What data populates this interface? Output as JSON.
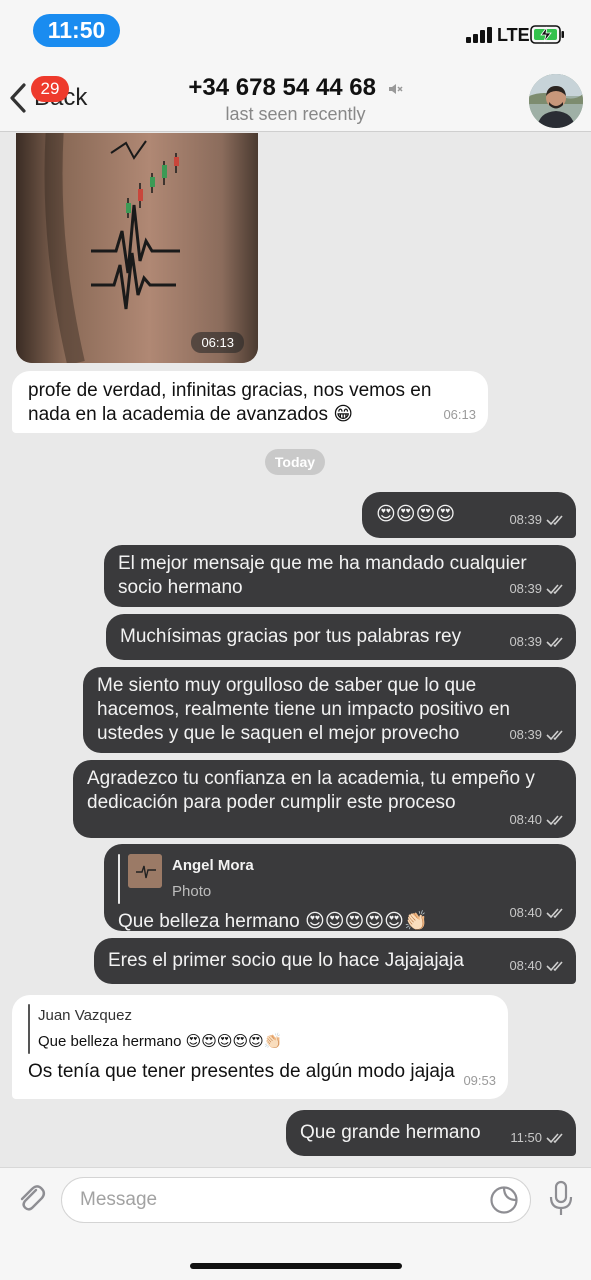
{
  "status_bar": {
    "time": "11:50",
    "network": "LTE"
  },
  "header": {
    "back_label": "Back",
    "unread_badge": "29",
    "contact_name": "+34 678 54 44 68",
    "contact_status": "last seen recently"
  },
  "photo": {
    "time": "06:13"
  },
  "messages": [
    {
      "id": "m1",
      "direction": "incoming",
      "text": "profe de verdad, infinitas gracias, nos vemos en nada en la academia de avanzados 😁",
      "time": "06:13"
    },
    {
      "id": "m2",
      "direction": "outgoing",
      "text": "😍😍😍😍",
      "time": "08:39"
    },
    {
      "id": "m3",
      "direction": "outgoing",
      "text": "El mejor mensaje que me ha mandado cualquier socio hermano",
      "time": "08:39"
    },
    {
      "id": "m4",
      "direction": "outgoing",
      "text": "Muchísimas gracias por tus palabras rey",
      "time": "08:39"
    },
    {
      "id": "m5",
      "direction": "outgoing",
      "text": "Me siento muy orgulloso de saber que lo que hacemos, realmente tiene un impacto positivo en ustedes y que le saquen el mejor provecho",
      "time": "08:39"
    },
    {
      "id": "m6",
      "direction": "outgoing",
      "text": "Agradezco tu confianza en la academia, tu empeño y dedicación para poder cumplir este proceso",
      "time": "08:40"
    },
    {
      "id": "m7",
      "direction": "outgoing",
      "reply_author": "Angel Mora",
      "reply_text": "Photo",
      "text": "Que belleza hermano 😍😍😍😍😍👏🏻",
      "time": "08:40"
    },
    {
      "id": "m8",
      "direction": "outgoing",
      "text": "Eres el primer socio que lo hace Jajajajaja",
      "time": "08:40"
    },
    {
      "id": "m9",
      "direction": "incoming",
      "reply_author": "Juan Vazquez",
      "reply_text": "Que belleza hermano 😍😍😍😍😍👏🏻",
      "text": "Os tenía que tener presentes de algún modo jajaja",
      "time": "09:53"
    },
    {
      "id": "m10",
      "direction": "outgoing",
      "text": "Que grande hermano",
      "time": "11:50"
    }
  ],
  "day_separator": "Today",
  "input": {
    "placeholder": "Message",
    "value": ""
  },
  "icons": {
    "back": "chevron-left-icon",
    "mute": "speaker-muted-icon",
    "attach": "paperclip-icon",
    "sticker": "sticker-icon",
    "mic": "microphone-icon",
    "read": "double-check-icon"
  },
  "colors": {
    "accent_time": "#1a8cf0",
    "badge": "#ee3a2c",
    "outgoing_bubble": "#3a3a3c",
    "incoming_bubble": "#ffffff"
  }
}
